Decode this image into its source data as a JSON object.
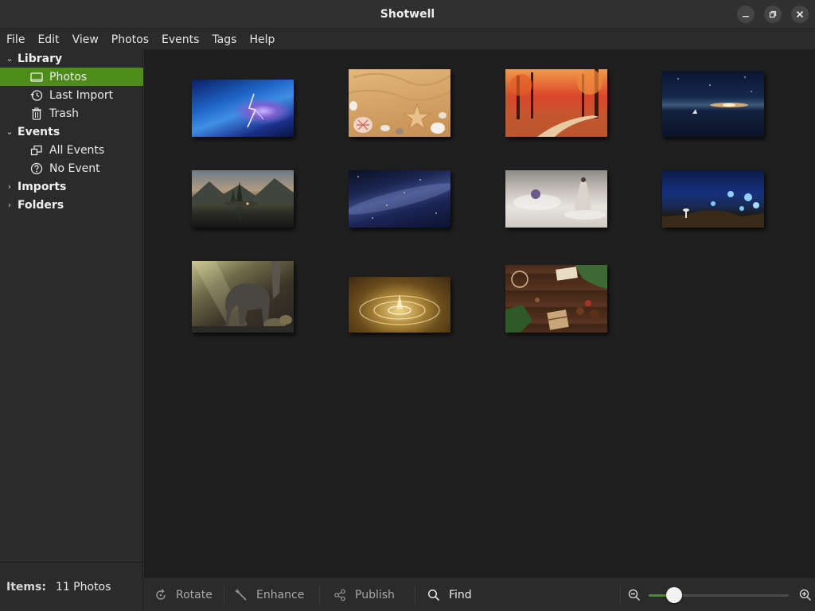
{
  "window": {
    "title": "Shotwell"
  },
  "menu": [
    "File",
    "Edit",
    "View",
    "Photos",
    "Events",
    "Tags",
    "Help"
  ],
  "sidebar": {
    "library": {
      "label": "Library",
      "items": [
        "Photos",
        "Last Import",
        "Trash"
      ]
    },
    "events": {
      "label": "Events",
      "items": [
        "All Events",
        "No Event"
      ]
    },
    "imports": {
      "label": "Imports"
    },
    "folders": {
      "label": "Folders"
    },
    "selected": "Photos"
  },
  "status": {
    "items_label": "Items:",
    "items_value": "11 Photos"
  },
  "toolbar": {
    "rotate": "Rotate",
    "enhance": "Enhance",
    "publish": "Publish",
    "find": "Find",
    "zoom_level": 0.18
  },
  "photos": [
    {
      "name": "lightning-storm"
    },
    {
      "name": "beach-starfish-shells"
    },
    {
      "name": "autumn-forest-path"
    },
    {
      "name": "night-sea-boat"
    },
    {
      "name": "lake-island-reflection"
    },
    {
      "name": "milky-way"
    },
    {
      "name": "woman-in-clouds"
    },
    {
      "name": "blue-butterflies-forest"
    },
    {
      "name": "baby-elephant"
    },
    {
      "name": "water-drop-splash"
    },
    {
      "name": "christmas-wood-table"
    }
  ],
  "colors": {
    "accent": "#4e8c1a",
    "background": "#2b2b2b",
    "content_bg": "#1f1f1f"
  }
}
